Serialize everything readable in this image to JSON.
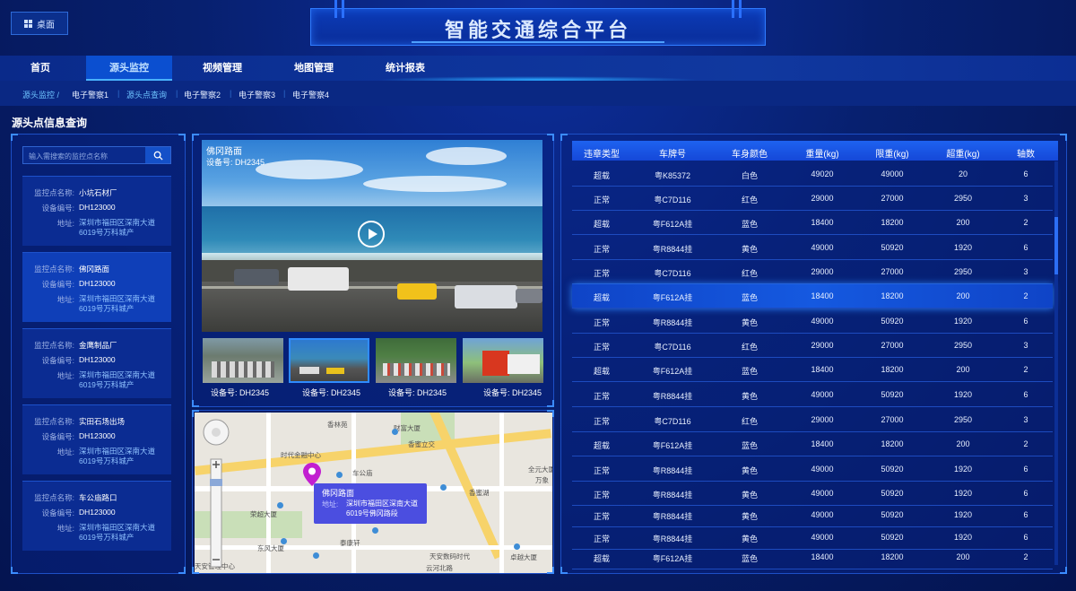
{
  "header": {
    "desktop_label": "桌面",
    "title": "智能交通综合平台"
  },
  "nav": {
    "tabs": [
      {
        "label": "首页"
      },
      {
        "label": "源头监控"
      },
      {
        "label": "视频管理"
      },
      {
        "label": "地图管理"
      },
      {
        "label": "统计报表"
      }
    ],
    "active": "源头监控"
  },
  "breadcrumb": {
    "items": [
      "源头监控 /",
      "电子警察1",
      "源头点查询",
      "电子警察2",
      "电子警察3",
      "电子警察4"
    ]
  },
  "section_title": "源头点信息查询",
  "search": {
    "placeholder": "输入需搜索的监控点名称"
  },
  "cards": {
    "labels": {
      "name": "监控点名称:",
      "device": "设备编号:",
      "addr": "地址:"
    },
    "items": [
      {
        "name": "小坑石材厂",
        "device": "DH123000",
        "addr": "深圳市福田区深南大道6019号万科城产"
      },
      {
        "name": "佛冈路面",
        "device": "DH123000",
        "addr": "深圳市福田区深南大道6019号万科城产"
      },
      {
        "name": "金鹰制品厂",
        "device": "DH123000",
        "addr": "深圳市福田区深南大道6019号万科城产"
      },
      {
        "name": "实田石场出场",
        "device": "DH123000",
        "addr": "深圳市福田区深南大道6019号万科城产"
      },
      {
        "name": "车公庙路口",
        "device": "DH123000",
        "addr": "深圳市福田区深南大道6019号万科城产"
      }
    ]
  },
  "video": {
    "title": "佛冈路面",
    "device": "设备号: DH2345",
    "thumbs": [
      "设备号: DH2345",
      "设备号: DH2345",
      "设备号: DH2345",
      "设备号: DH2345"
    ]
  },
  "map": {
    "tooltip_title": "佛冈路面",
    "tooltip_label": "地址:",
    "tooltip_addr": "深圳市福田区深南大道6019号佛冈路段",
    "pois": [
      "香林苑",
      "财富大厦",
      "时代金融中心",
      "车公庙",
      "香蜜立交",
      "荣超大厦",
      "泰康轩",
      "东风大厦",
      "天安数码时代",
      "香蜜湖",
      "天安管理中心",
      "卓越大厦",
      "云河北路",
      "全元大厦",
      "万象"
    ]
  },
  "table": {
    "headers": [
      "违章类型",
      "车牌号",
      "车身颜色",
      "重量(kg)",
      "限重(kg)",
      "超重(kg)",
      "轴数"
    ],
    "rows": [
      [
        "超载",
        "粤K85372",
        "白色",
        "49020",
        "49000",
        "20",
        "6"
      ],
      [
        "正常",
        "粤C7D116",
        "红色",
        "29000",
        "27000",
        "2950",
        "3"
      ],
      [
        "超载",
        "粤F612A挂",
        "蓝色",
        "18400",
        "18200",
        "200",
        "2"
      ],
      [
        "正常",
        "粤R8844挂",
        "黄色",
        "49000",
        "50920",
        "1920",
        "6"
      ],
      [
        "正常",
        "粤C7D116",
        "红色",
        "29000",
        "27000",
        "2950",
        "3"
      ],
      [
        "超载",
        "粤F612A挂",
        "蓝色",
        "18400",
        "18200",
        "200",
        "2"
      ],
      [
        "正常",
        "粤R8844挂",
        "黄色",
        "49000",
        "50920",
        "1920",
        "6"
      ],
      [
        "正常",
        "粤C7D116",
        "红色",
        "29000",
        "27000",
        "2950",
        "3"
      ],
      [
        "超载",
        "粤F612A挂",
        "蓝色",
        "18400",
        "18200",
        "200",
        "2"
      ],
      [
        "正常",
        "粤R8844挂",
        "黄色",
        "49000",
        "50920",
        "1920",
        "6"
      ],
      [
        "正常",
        "粤C7D116",
        "红色",
        "29000",
        "27000",
        "2950",
        "3"
      ],
      [
        "超载",
        "粤F612A挂",
        "蓝色",
        "18400",
        "18200",
        "200",
        "2"
      ],
      [
        "正常",
        "粤R8844挂",
        "黄色",
        "49000",
        "50920",
        "1920",
        "6"
      ],
      [
        "正常",
        "粤R8844挂",
        "黄色",
        "49000",
        "50920",
        "1920",
        "6"
      ],
      [
        "正常",
        "粤R8844挂",
        "黄色",
        "49000",
        "50920",
        "1920",
        "6"
      ],
      [
        "正常",
        "粤R8844挂",
        "黄色",
        "49000",
        "50920",
        "1920",
        "6"
      ],
      [
        "超载",
        "粤F612A挂",
        "蓝色",
        "18400",
        "18200",
        "200",
        "2"
      ]
    ],
    "highlighted_row": 5
  },
  "colors": {
    "accent": "#2f8cff",
    "background": "#061a6e",
    "tooltip": "#4b4ee0",
    "pin": "#c21fd0"
  }
}
